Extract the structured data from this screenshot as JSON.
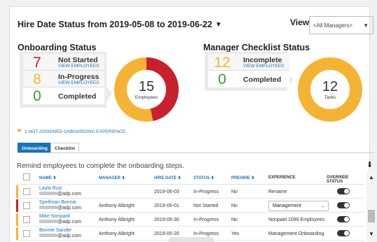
{
  "header": {
    "title": "Hire Date Status from 2019-05-08 to 2019-06-22",
    "view_label": "View",
    "view_value": "<All Managers>"
  },
  "onboarding": {
    "title": "Onboarding Status",
    "stats": [
      {
        "value": "7",
        "label": "Not Started",
        "link": "VIEW EMPLOYEES",
        "color": "#c8202d"
      },
      {
        "value": "8",
        "label": "In-Progress",
        "link": "VIEW EMPLOYEES",
        "color": "#f5b335"
      },
      {
        "value": "0",
        "label": "Completed",
        "link": "",
        "color": "#3a9a35"
      }
    ],
    "donut": {
      "center_value": "15",
      "center_label": "Employees",
      "segments": [
        {
          "value": 7,
          "color": "#c8202d"
        },
        {
          "value": 8,
          "color": "#f5b335"
        }
      ]
    }
  },
  "checklist": {
    "title": "Manager Checklist Status",
    "stats": [
      {
        "value": "12",
        "label": "Incomplete",
        "link": "VIEW EMPLOYEES",
        "color": "#f5b335"
      },
      {
        "value": "0",
        "label": "Completed",
        "link": "",
        "color": "#3a9a35"
      }
    ],
    "donut": {
      "center_value": "12",
      "center_label": "Tasks",
      "segments": [
        {
          "value": 12,
          "color": "#f5b335"
        }
      ]
    }
  },
  "notice": "1 NOT ASSIGNED ONBOARDING EXPERIENCE",
  "tabs": [
    "Onboarding",
    "Checklist"
  ],
  "remind_text": "Remind employees to complete the onboarding steps.",
  "table": {
    "columns": [
      "NAME ⬍",
      "MANAGER ⬍",
      "HIRE DATE ⬍",
      "STATUS ⬍",
      "PREHIRE ⬍",
      "EXPERIENCE",
      "OVERRIDE STATUS"
    ],
    "rows": [
      {
        "name": "Layla Ruiz",
        "email": "@adp.com",
        "manager": "",
        "hire_date": "2019-06-03",
        "status": "In-Progress",
        "prehire": "No",
        "experience": "Rename",
        "experience_select": false,
        "bar": "#f5b335"
      },
      {
        "name": "Spellman Bonnie",
        "email": "@adp.com",
        "manager": "Anthony Albright",
        "hire_date": "2019-06-01",
        "status": "Not Started",
        "prehire": "No",
        "experience": "Management",
        "experience_select": true,
        "bar": "#c8202d"
      },
      {
        "name": "Mike Nonpard",
        "email": "@adp.com",
        "manager": "Anthony Albright",
        "hire_date": "2019-05-30",
        "status": "In-Progress",
        "prehire": "No",
        "experience": "Nonpaid 1099 Employees",
        "experience_select": false,
        "bar": "#f5b335"
      },
      {
        "name": "Bonnie Sander",
        "email": "@adp.com",
        "manager": "Anthony Albright",
        "hire_date": "2019-05-20",
        "status": "In-Progress",
        "prehire": "Yes",
        "experience": "Management Onboarding",
        "experience_select": false,
        "bar": "#f5b335"
      }
    ]
  }
}
